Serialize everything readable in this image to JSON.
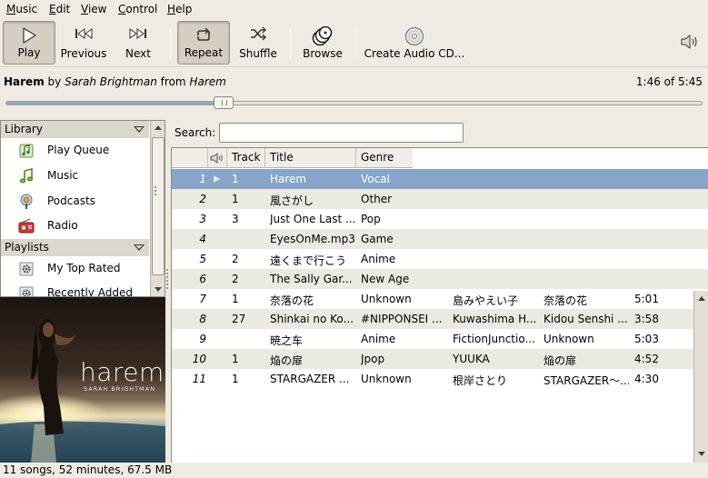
{
  "menubar": {
    "items": [
      "Music",
      "Edit",
      "View",
      "Control",
      "Help"
    ],
    "underline": [
      "M",
      "E",
      "V",
      "C",
      "H"
    ]
  },
  "toolbar": {
    "play": "Play",
    "previous": "Previous",
    "next": "Next",
    "repeat": "Repeat",
    "shuffle": "Shuffle",
    "browse": "Browse",
    "create_cd": "Create Audio CD...",
    "volume_icon": "speaker-volume-icon",
    "repeat_pressed": true
  },
  "now_playing": {
    "title": "Harem",
    "by": "by",
    "artist": "Sarah Brightman",
    "from": "from",
    "album": "Harem",
    "elapsed": "1:46 of 5:45",
    "progress_fraction": 0.307
  },
  "sidebar": {
    "library_header": "Library",
    "library_items": [
      {
        "label": "Play Queue",
        "icon": "play-queue-icon"
      },
      {
        "label": "Music",
        "icon": "music-note-icon"
      },
      {
        "label": "Podcasts",
        "icon": "podcast-icon"
      },
      {
        "label": "Radio",
        "icon": "radio-icon"
      }
    ],
    "playlists_header": "Playlists",
    "playlist_items": [
      {
        "label": "My Top Rated",
        "icon": "smart-playlist-gear-icon"
      },
      {
        "label": "Recently Added",
        "icon": "smart-playlist-gear-icon"
      }
    ]
  },
  "album_art": {
    "title_text": "harem",
    "artist_text": "SARAH BRIGHTMAN"
  },
  "search": {
    "label": "Search:",
    "value": "",
    "placeholder": ""
  },
  "tracklist": {
    "columns": [
      "",
      "Track",
      "Title",
      "Genre"
    ],
    "rows": [
      {
        "n": "1",
        "track": "1",
        "title": "Harem",
        "genre": "Vocal",
        "artist": "",
        "album": "",
        "time": "",
        "playing": true
      },
      {
        "n": "2",
        "track": "1",
        "title": "風さがし",
        "genre": "Other",
        "artist": "",
        "album": "",
        "time": ""
      },
      {
        "n": "3",
        "track": "3",
        "title": "Just One Last ...",
        "genre": "Pop",
        "artist": "",
        "album": "",
        "time": ""
      },
      {
        "n": "4",
        "track": "",
        "title": "EyesOnMe.mp3",
        "genre": "Game",
        "artist": "",
        "album": "",
        "time": ""
      },
      {
        "n": "5",
        "track": "2",
        "title": "遠くまで行こう",
        "genre": "Anime",
        "artist": "",
        "album": "",
        "time": ""
      },
      {
        "n": "6",
        "track": "2",
        "title": "The Sally Gar...",
        "genre": "New Age",
        "artist": "",
        "album": "",
        "time": ""
      },
      {
        "n": "7",
        "track": "1",
        "title": "奈落の花",
        "genre": "Unknown",
        "artist": "島みやえい子",
        "album": "奈落の花",
        "time": "5:01"
      },
      {
        "n": "8",
        "track": "27",
        "title": "Shinkai no Ko...",
        "genre": "#NIPPONSEI ...",
        "artist": "Kuwashima H...",
        "album": "Kidou Senshi ...",
        "time": "3:58"
      },
      {
        "n": "9",
        "track": "",
        "title": "暁之车",
        "genre": "Anime",
        "artist": "FictionJunctio...",
        "album": "Unknown",
        "time": "5:03"
      },
      {
        "n": "10",
        "track": "1",
        "title": "焔の扉",
        "genre": "Jpop",
        "artist": "YUUKA",
        "album": "焔の扉",
        "time": "4:52"
      },
      {
        "n": "11",
        "track": "1",
        "title": "STARGAZER ...",
        "genre": "Unknown",
        "artist": "根岸さとり",
        "album": "STARGAZER～...",
        "time": "4:30"
      }
    ]
  },
  "status": {
    "text": "11 songs, 52 minutes, 67.5 MB"
  },
  "colors": {
    "selection": "#86a5c9",
    "window_bg": "#efebe3"
  }
}
